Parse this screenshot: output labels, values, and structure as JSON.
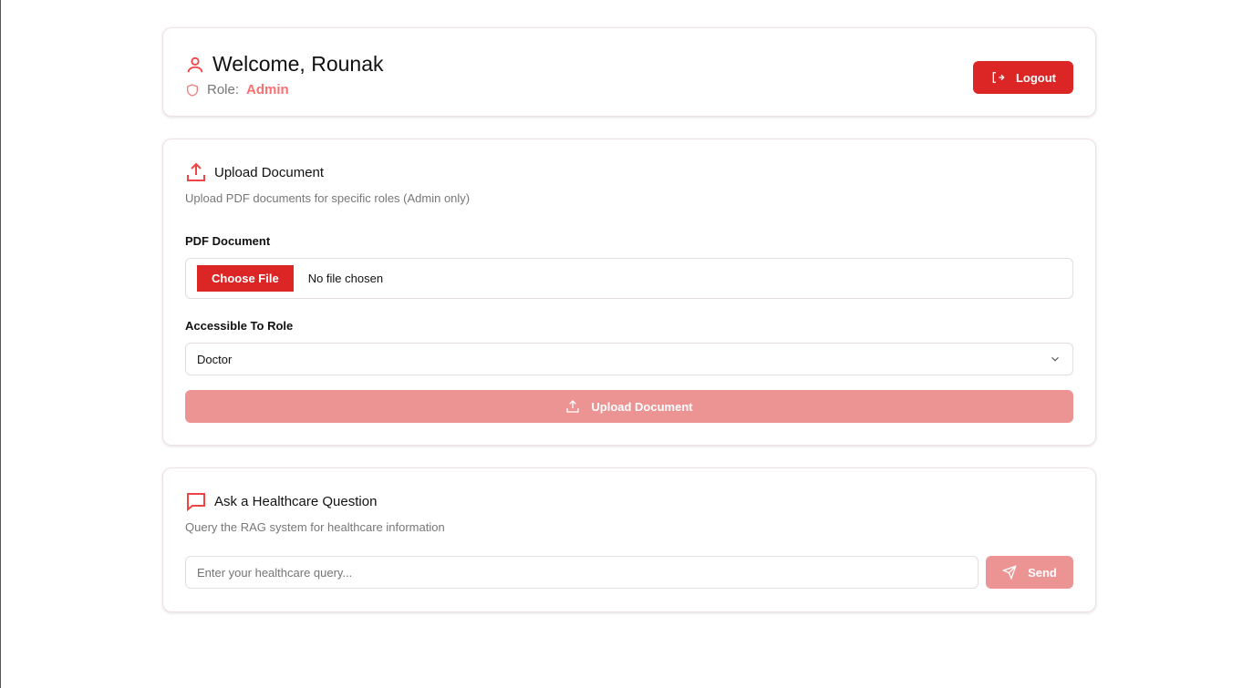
{
  "header": {
    "welcome": "Welcome, Rounak",
    "role_label": "Role:",
    "role_value": "Admin",
    "logout": "Logout"
  },
  "upload": {
    "title": "Upload Document",
    "subtitle": "Upload PDF documents for specific roles (Admin only)",
    "pdf_label": "PDF Document",
    "choose_file": "Choose File",
    "no_file": "No file chosen",
    "role_label": "Accessible To Role",
    "role_selected": "Doctor",
    "submit": "Upload Document"
  },
  "ask": {
    "title": "Ask a Healthcare Question",
    "subtitle": "Query the RAG system for healthcare information",
    "placeholder": "Enter your healthcare query...",
    "send": "Send"
  },
  "colors": {
    "accent": "#dc2626",
    "disabled": "#ec9494"
  }
}
